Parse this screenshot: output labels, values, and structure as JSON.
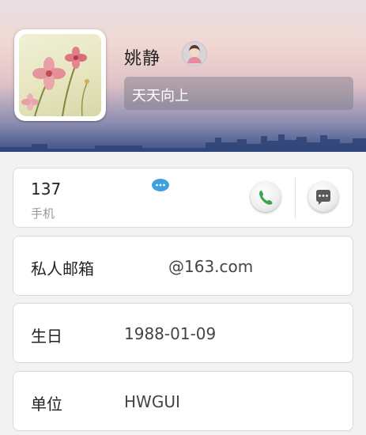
{
  "profile": {
    "name": "姚静",
    "signature": "天天向上"
  },
  "phone": {
    "number": "137",
    "type_label": "手机"
  },
  "email": {
    "label": "私人邮箱",
    "value": "@163.com"
  },
  "birthday": {
    "label": "生日",
    "value": "1988-01-09"
  },
  "organization": {
    "label": "单位",
    "value": "HWGUI"
  },
  "colors": {
    "call_green": "#3aa54a",
    "chat_blue": "#3f9fe0",
    "card_border": "#d9d9d9"
  },
  "icons": {
    "gender": "female-avatar-icon",
    "chat_badge": "speech-bubble-icon",
    "call": "phone-handset-icon",
    "message": "message-bubble-icon"
  }
}
